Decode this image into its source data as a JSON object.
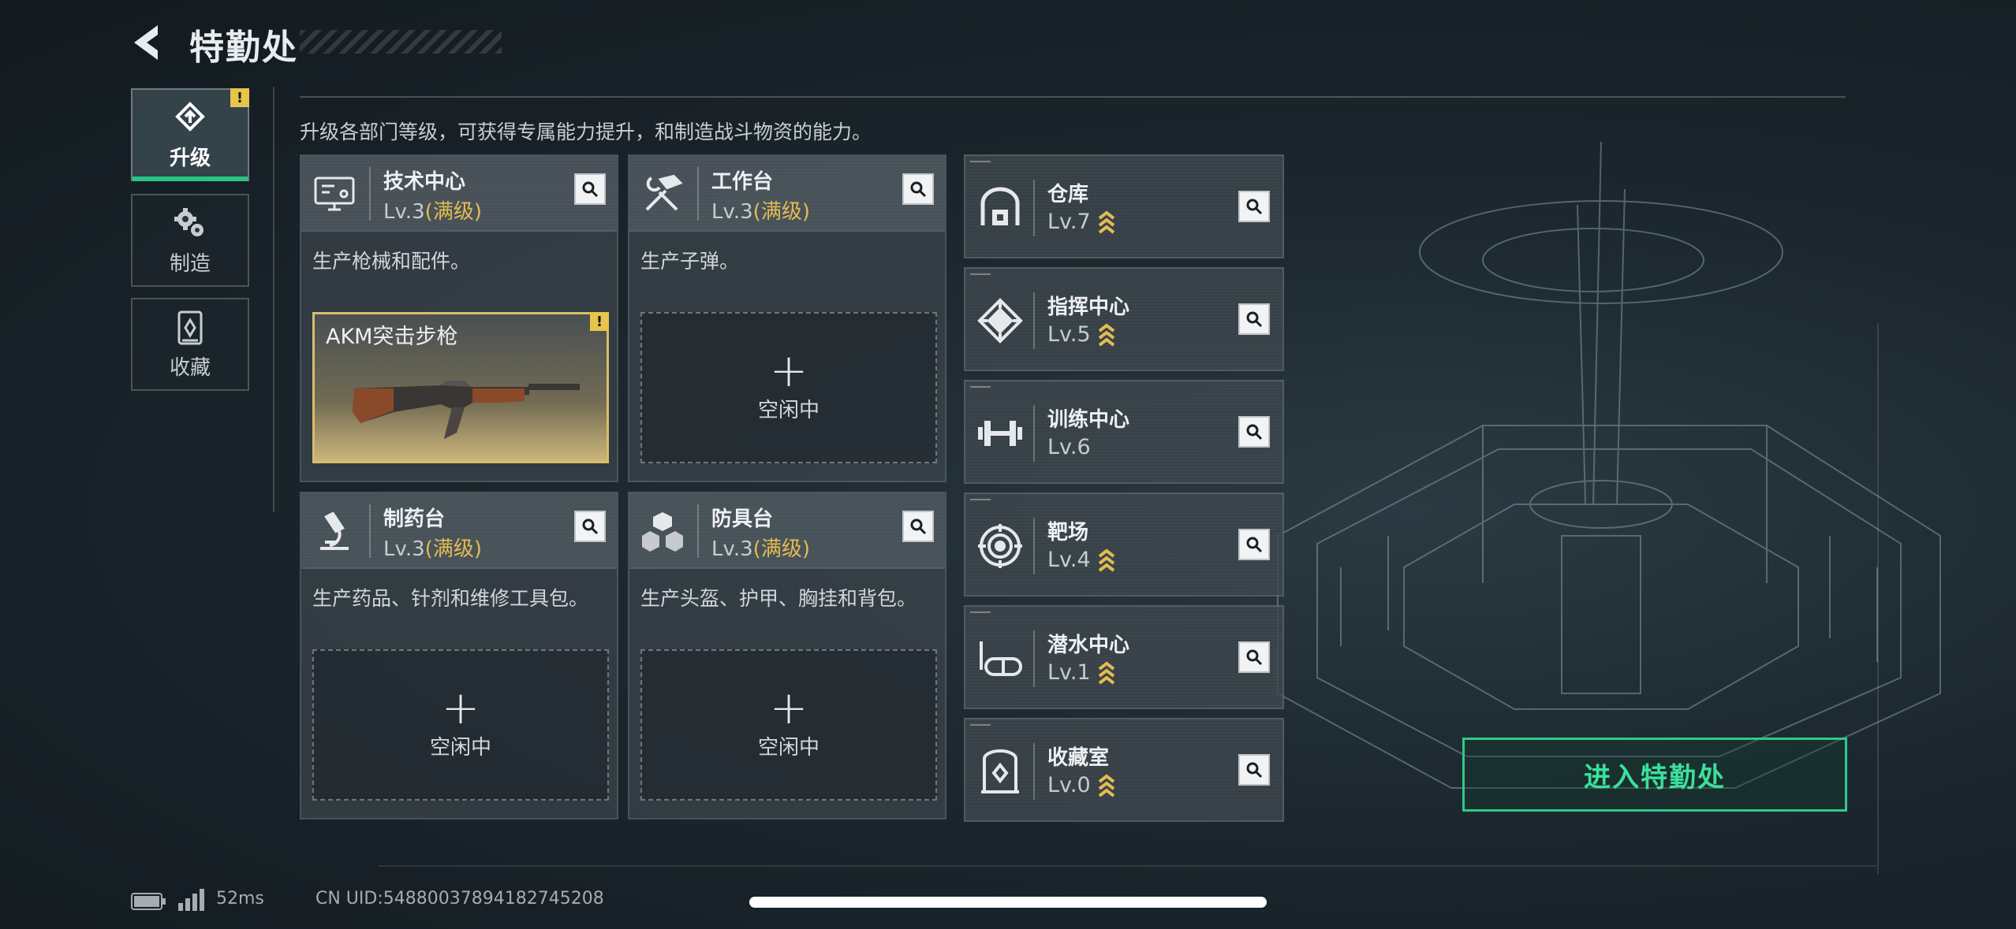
{
  "header": {
    "title": "特勤处"
  },
  "tabs": [
    {
      "label": "升级",
      "icon": "upgrade-icon",
      "active": true,
      "badge": "!"
    },
    {
      "label": "制造",
      "icon": "gears-icon",
      "active": false
    },
    {
      "label": "收藏",
      "icon": "collection-icon",
      "active": false
    }
  ],
  "subtitle": "升级各部门等级，可获得专属能力提升，和制造战斗物资的能力。",
  "departments": [
    {
      "name": "技术中心",
      "level": "Lv.3",
      "status": "(满级)",
      "desc": "生产枪械和配件。",
      "icon": "computer-icon",
      "slot": {
        "state": "producing",
        "item_name": "AKM突击步枪",
        "badge": "!"
      }
    },
    {
      "name": "工作台",
      "level": "Lv.3",
      "status": "(满级)",
      "desc": "生产子弹。",
      "icon": "tools-icon",
      "slot": {
        "state": "idle",
        "plus": "+",
        "label": "空闲中"
      }
    },
    {
      "name": "制药台",
      "level": "Lv.3",
      "status": "(满级)",
      "desc": "生产药品、针剂和维修工具包。",
      "icon": "microscope-icon",
      "slot": {
        "state": "idle",
        "plus": "+",
        "label": "空闲中"
      }
    },
    {
      "name": "防具台",
      "level": "Lv.3",
      "status": "(满级)",
      "desc": "生产头盔、护甲、胸挂和背包。",
      "icon": "armor-icon",
      "slot": {
        "state": "idle",
        "plus": "+",
        "label": "空闲中"
      }
    }
  ],
  "facilities": [
    {
      "name": "仓库",
      "level": "Lv.7",
      "upgradable": true,
      "icon": "warehouse-icon"
    },
    {
      "name": "指挥中心",
      "level": "Lv.5",
      "upgradable": true,
      "icon": "command-icon"
    },
    {
      "name": "训练中心",
      "level": "Lv.6",
      "upgradable": false,
      "icon": "dumbbell-icon"
    },
    {
      "name": "靶场",
      "level": "Lv.4",
      "upgradable": true,
      "icon": "target-icon"
    },
    {
      "name": "潜水中心",
      "level": "Lv.1",
      "upgradable": true,
      "icon": "diving-mask-icon"
    },
    {
      "name": "收藏室",
      "level": "Lv.0",
      "upgradable": true,
      "icon": "trophy-case-icon"
    }
  ],
  "enter_button": {
    "label": "进入特勤处"
  },
  "status_bar": {
    "ping": "52ms",
    "uid": "CN UID:54880037894182745208"
  },
  "colors": {
    "accent_green": "#2fc98a",
    "maxed_gold": "#e4bb52",
    "warning_yellow": "#e6c54a"
  }
}
